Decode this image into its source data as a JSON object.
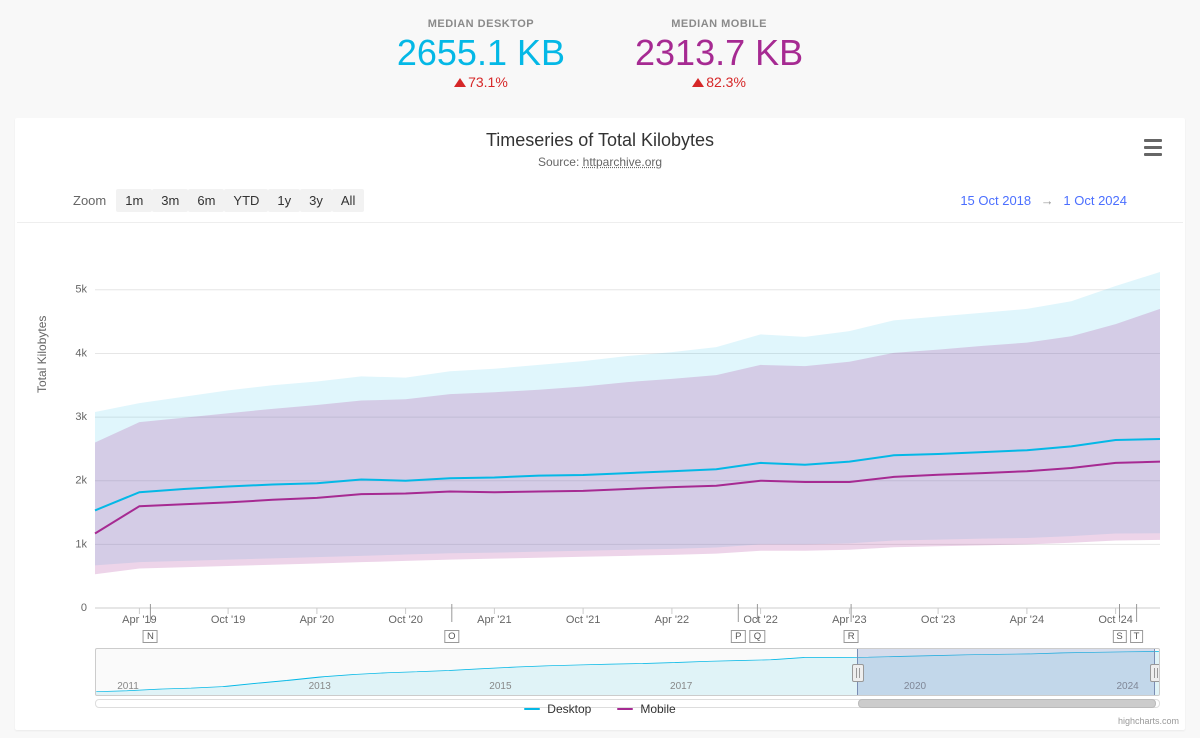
{
  "summary": {
    "desktop": {
      "label": "MEDIAN DESKTOP",
      "value": "2655.1 KB",
      "delta": "73.1%"
    },
    "mobile": {
      "label": "MEDIAN MOBILE",
      "value": "2313.7 KB",
      "delta": "82.3%"
    }
  },
  "card": {
    "title": "Timeseries of Total Kilobytes",
    "source_prefix": "Source: ",
    "source_link": "httparchive.org"
  },
  "controls": {
    "zoom_label": "Zoom",
    "zooms": [
      "1m",
      "3m",
      "6m",
      "YTD",
      "1y",
      "3y",
      "All"
    ],
    "range_from": "15 Oct 2018",
    "range_arrow": "→",
    "range_to": "1 Oct 2024"
  },
  "axes": {
    "y_label": "Total Kilobytes",
    "y_ticks": [
      0,
      1000,
      2000,
      3000,
      4000,
      5000
    ],
    "y_tick_labels": [
      "0",
      "1k",
      "2k",
      "3k",
      "4k",
      "5k"
    ],
    "y_max": 5500,
    "x_ticks": [
      "Apr '19",
      "Oct '19",
      "Apr '20",
      "Oct '20",
      "Apr '21",
      "Oct '21",
      "Apr '22",
      "Oct '22",
      "Apr '23",
      "Oct '23",
      "Apr '24",
      "Oct '24"
    ],
    "markers": [
      {
        "label": "N",
        "pos": 0.052
      },
      {
        "label": "O",
        "pos": 0.335
      },
      {
        "label": "P",
        "pos": 0.604
      },
      {
        "label": "Q",
        "pos": 0.622
      },
      {
        "label": "R",
        "pos": 0.71
      },
      {
        "label": "S",
        "pos": 0.962
      },
      {
        "label": "T",
        "pos": 0.978
      }
    ]
  },
  "navigator": {
    "labels": [
      {
        "text": "2011",
        "pos": 0.02
      },
      {
        "text": "2013",
        "pos": 0.2
      },
      {
        "text": "2015",
        "pos": 0.37
      },
      {
        "text": "2017",
        "pos": 0.54
      },
      {
        "text": "2020",
        "pos": 0.76
      },
      {
        "text": "2024",
        "pos": 0.96
      }
    ],
    "selection": {
      "from": 0.716,
      "to": 0.996
    },
    "mini_line": [
      200,
      260,
      360,
      420,
      520,
      720,
      900,
      1100,
      1250,
      1350,
      1420,
      1500,
      1600,
      1700,
      1780,
      1830,
      1880,
      1920,
      1980,
      2050,
      2100,
      2150,
      2280,
      2280,
      2300,
      2350,
      2400,
      2450,
      2480,
      2500,
      2560,
      2600,
      2630,
      2655
    ],
    "mini_max": 2800
  },
  "legend": {
    "desktop": "Desktop",
    "mobile": "Mobile"
  },
  "credit": "highcharts.com",
  "chart_data": {
    "type": "line",
    "title": "Timeseries of Total Kilobytes",
    "xlabel": "",
    "ylabel": "Total Kilobytes",
    "x_range_label": "15 Oct 2018 – 1 Oct 2024",
    "ylim": [
      0,
      5500
    ],
    "x": [
      "2018-10",
      "2019-01",
      "2019-04",
      "2019-07",
      "2019-10",
      "2020-01",
      "2020-04",
      "2020-07",
      "2020-10",
      "2021-01",
      "2021-04",
      "2021-07",
      "2021-10",
      "2022-01",
      "2022-04",
      "2022-07",
      "2022-10",
      "2023-01",
      "2023-04",
      "2023-07",
      "2023-10",
      "2024-01",
      "2024-04",
      "2024-07",
      "2024-10"
    ],
    "series": [
      {
        "name": "Desktop",
        "color": "#04b8e6",
        "values": [
          1534,
          1820,
          1870,
          1910,
          1940,
          1960,
          2020,
          2000,
          2040,
          2050,
          2080,
          2090,
          2120,
          2150,
          2180,
          2280,
          2250,
          2300,
          2400,
          2420,
          2450,
          2480,
          2540,
          2640,
          2655
        ],
        "band_low": [
          670,
          720,
          740,
          760,
          780,
          800,
          820,
          840,
          860,
          870,
          885,
          900,
          915,
          930,
          950,
          1000,
          1000,
          1015,
          1060,
          1075,
          1090,
          1100,
          1130,
          1170,
          1175
        ],
        "band_high": [
          3080,
          3220,
          3320,
          3420,
          3500,
          3560,
          3640,
          3620,
          3720,
          3760,
          3820,
          3880,
          3960,
          4020,
          4100,
          4300,
          4260,
          4350,
          4520,
          4580,
          4640,
          4700,
          4820,
          5060,
          5280
        ]
      },
      {
        "name": "Mobile",
        "color": "#a62a92",
        "values": [
          1170,
          1600,
          1630,
          1660,
          1700,
          1730,
          1790,
          1800,
          1830,
          1820,
          1830,
          1840,
          1870,
          1900,
          1920,
          2000,
          1980,
          1980,
          2060,
          2095,
          2120,
          2150,
          2200,
          2280,
          2300
        ],
        "band_low": [
          530,
          620,
          640,
          660,
          680,
          700,
          720,
          740,
          760,
          775,
          790,
          805,
          820,
          835,
          855,
          900,
          900,
          915,
          955,
          970,
          985,
          1000,
          1025,
          1060,
          1070
        ],
        "band_high": [
          2600,
          2920,
          2990,
          3060,
          3130,
          3190,
          3260,
          3280,
          3360,
          3390,
          3430,
          3480,
          3550,
          3600,
          3660,
          3820,
          3800,
          3870,
          4010,
          4060,
          4120,
          4170,
          4270,
          4460,
          4700
        ]
      }
    ]
  }
}
